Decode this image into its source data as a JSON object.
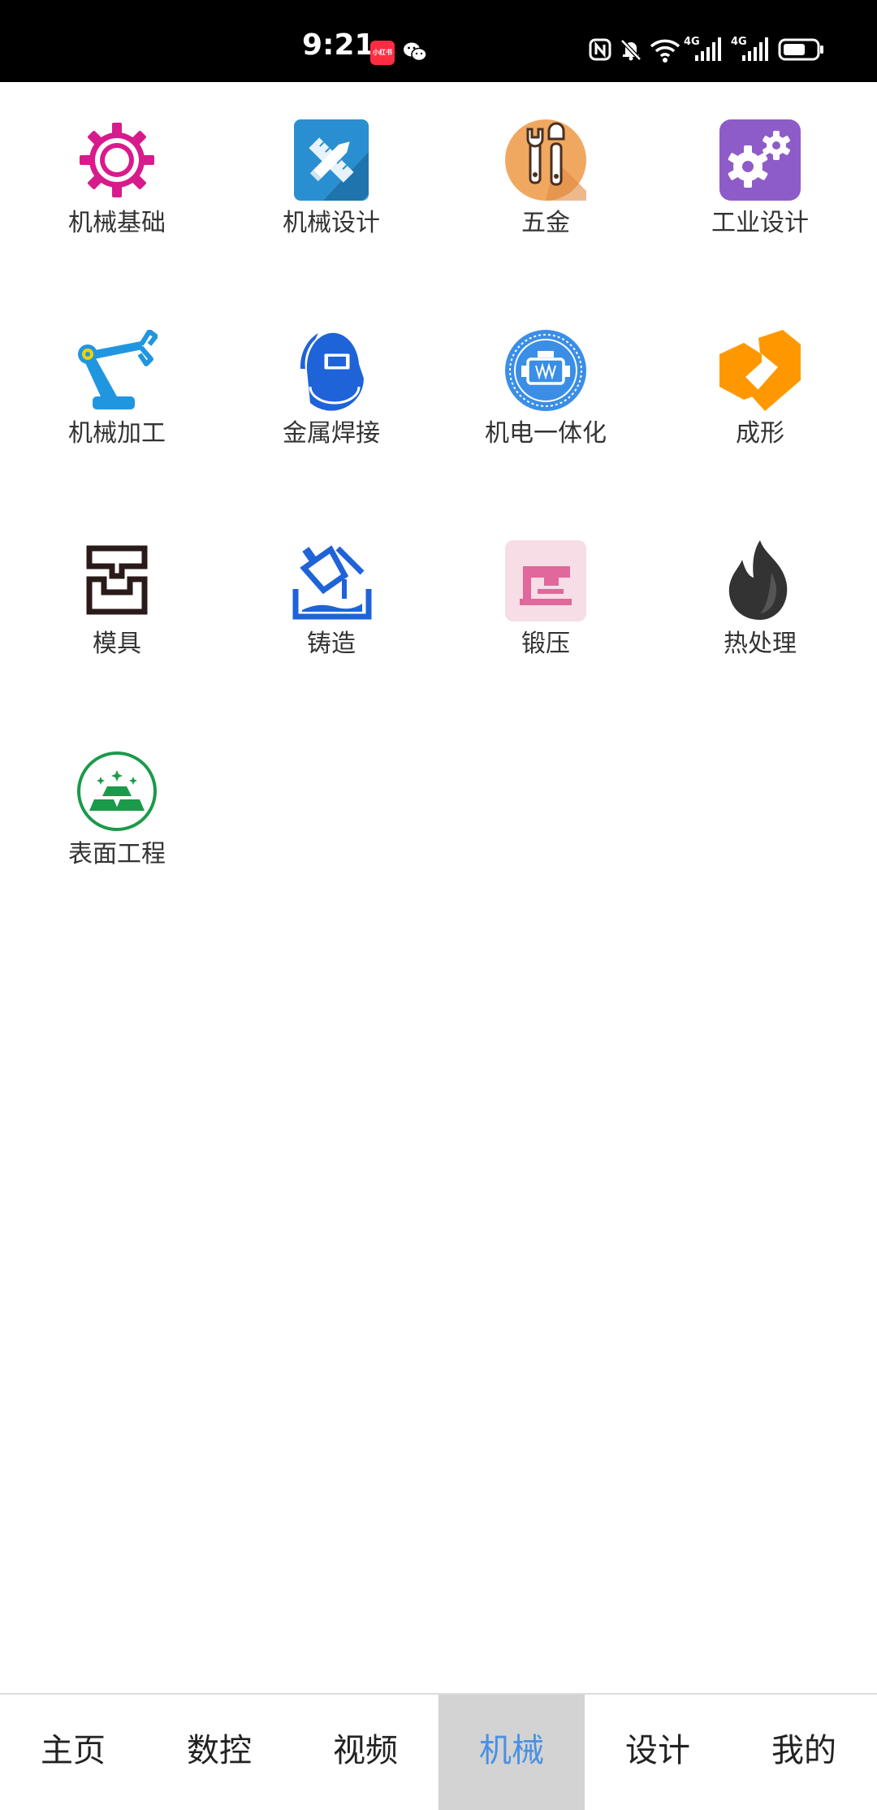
{
  "status_bar": {
    "time": "9:21",
    "badge_text": "小红书",
    "network_label_1": "4G",
    "network_label_2": "4G"
  },
  "grid": [
    {
      "label": "机械基础",
      "icon": "gear-icon",
      "color": "#d81b8c"
    },
    {
      "label": "机械设计",
      "icon": "pencil-ruler-icon",
      "color": "#2a8fd0"
    },
    {
      "label": "五金",
      "icon": "wrench-icon",
      "color": "#f0a860"
    },
    {
      "label": "工业设计",
      "icon": "gears-icon",
      "color": "#8e5cc8"
    },
    {
      "label": "机械加工",
      "icon": "robot-arm-icon",
      "color": "#2196e0"
    },
    {
      "label": "金属焊接",
      "icon": "welding-helmet-icon",
      "color": "#1f63d8"
    },
    {
      "label": "机电一体化",
      "icon": "engine-icon",
      "color": "#3a8ee6"
    },
    {
      "label": "成形",
      "icon": "forming-icon",
      "color": "#ff9800"
    },
    {
      "label": "模具",
      "icon": "mold-icon",
      "color": "#2a1a1a"
    },
    {
      "label": "铸造",
      "icon": "casting-icon",
      "color": "#1f63d8"
    },
    {
      "label": "锻压",
      "icon": "forging-press-icon",
      "color": "#e0689a"
    },
    {
      "label": "热处理",
      "icon": "flame-icon",
      "color": "#333333"
    },
    {
      "label": "表面工程",
      "icon": "gold-bars-icon",
      "color": "#1a9a4a"
    }
  ],
  "bottom_nav": {
    "tabs": [
      "主页",
      "数控",
      "视频",
      "机械",
      "设计",
      "我的"
    ],
    "active_index": 3,
    "active_color": "#4a90e2"
  }
}
